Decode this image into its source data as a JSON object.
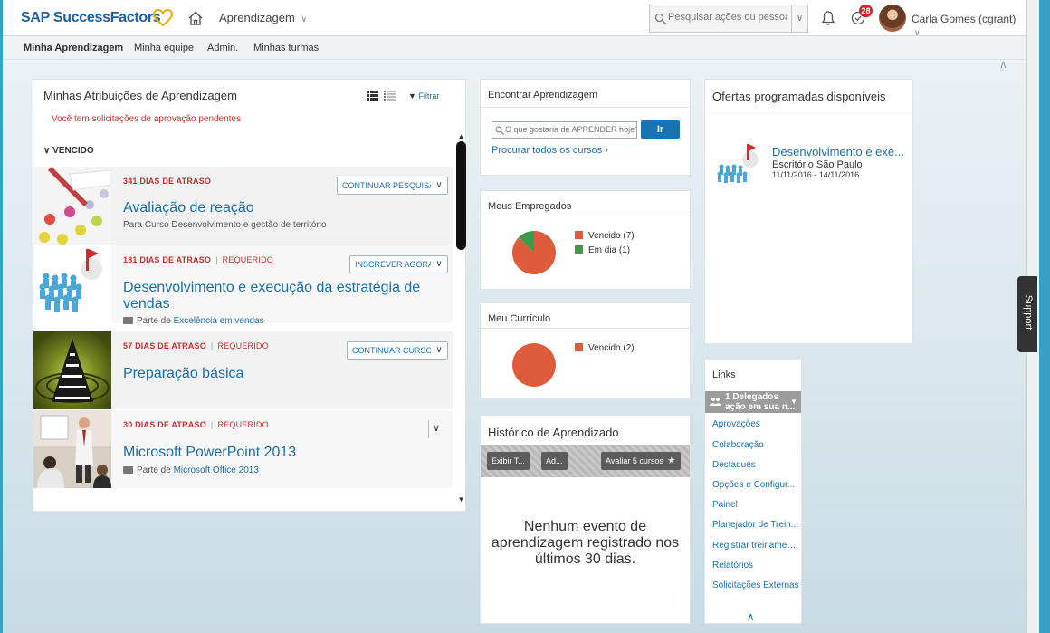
{
  "header": {
    "logo": "SAP SuccessFactors",
    "module": "Aprendizagem",
    "search_placeholder": "Pesquisar ações ou pessoas",
    "todo_count": "28",
    "user": "Carla Gomes (cgrant)"
  },
  "subnav": {
    "items": [
      "Minha Aprendizagem",
      "Minha equipe",
      "Admin.",
      "Minhas turmas"
    ]
  },
  "assignments": {
    "title": "Minhas Atribuições de Aprendizagem",
    "filter_label": "Filtrar",
    "pending_notice": "Você tem solicitações de aprovação pendentes",
    "section_overdue": "VENCIDO",
    "rows": [
      {
        "status": "341 DIAS DE ATRASO",
        "required": "",
        "title": "Avaliação de reação",
        "subtitle": "Para Curso Desenvolvimento e gestão de território",
        "part_of": "",
        "action": "CONTINUAR PESQUISA"
      },
      {
        "status": "181 DIAS DE ATRASO",
        "required": "REQUERIDO",
        "title": "Desenvolvimento e execução da estratégia de vendas",
        "subtitle": "Parte de",
        "part_of": "Excelência em vendas",
        "action": "INSCREVER AGORA"
      },
      {
        "status": "57 DIAS DE ATRASO",
        "required": "REQUERIDO",
        "title": "Preparação básica",
        "subtitle": "",
        "part_of": "",
        "action": "CONTINUAR CURSO"
      },
      {
        "status": "30 DIAS DE ATRASO",
        "required": "REQUERIDO",
        "title": "Microsoft PowerPoint 2013",
        "subtitle": "Parte de",
        "part_of": "Microsoft Office 2013",
        "action": ""
      }
    ]
  },
  "find_learning": {
    "title": "Encontrar Aprendizagem",
    "placeholder": "O que gostaria de APRENDER hoje?",
    "go_label": "Ir",
    "browse_label": "Procurar todos os cursos"
  },
  "employees": {
    "title": "Meus Empregados",
    "legend": [
      {
        "label": "Vencido (7)",
        "value": 7,
        "color": "#dd5c3c"
      },
      {
        "label": "Em dia (1)",
        "value": 1,
        "color": "#3c9a4c"
      }
    ]
  },
  "curriculum": {
    "title": "Meu Currículo",
    "legend": [
      {
        "label": "Vencido (2)",
        "value": 2,
        "color": "#dd5c3c"
      }
    ]
  },
  "history": {
    "title": "Histórico de Aprendizado",
    "btn_show": "Exibir T...",
    "btn_add": "Ad...",
    "btn_rate": "Avaliar 5 cursos",
    "empty_message": "Nenhum evento de aprendizagem registrado nos últimos 30 dias."
  },
  "offerings": {
    "title": "Ofertas programadas disponíveis",
    "item_title": "Desenvolvimento e exe...",
    "item_location": "Escritório São Paulo",
    "item_dates": "11/11/2016 - 14/11/2016"
  },
  "links": {
    "title": "Links",
    "delegates": "1 Delegados ação em sua n...",
    "items": [
      "Aprovações",
      "Colaboração",
      "Destaques",
      "Opções e Configur...",
      "Painel",
      "Planejador de Trein...",
      "Registrar treinamento",
      "Relatórios",
      "Solicitações Externas"
    ]
  },
  "support_label": "Support",
  "colors": {
    "brand": "#1b5fa7",
    "link": "#1b6fa8",
    "overdue": "#c9302c",
    "button": "#1873b4"
  }
}
